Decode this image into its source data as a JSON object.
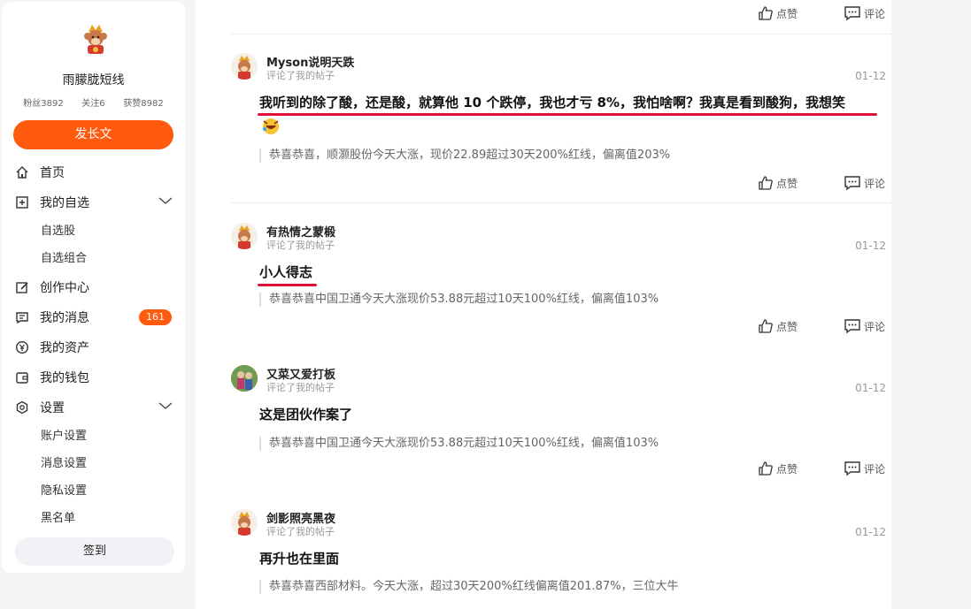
{
  "sidebar": {
    "user_name": "雨朦胧短线",
    "stats": {
      "fans": "粉丝3892",
      "follow": "关注6",
      "likes": "获赞8982"
    },
    "post_button": "发长文",
    "nav": [
      {
        "label": "首页",
        "icon": "home-icon"
      },
      {
        "label": "我的自选",
        "icon": "watchlist-icon"
      },
      {
        "label": "自选股"
      },
      {
        "label": "自选组合"
      },
      {
        "label": "创作中心",
        "icon": "edit-icon"
      },
      {
        "label": "我的消息",
        "icon": "message-icon",
        "badge": "161"
      },
      {
        "label": "我的资产",
        "icon": "asset-icon"
      },
      {
        "label": "我的钱包",
        "icon": "wallet-icon"
      },
      {
        "label": "设置",
        "icon": "settings-icon"
      },
      {
        "label": "账户设置"
      },
      {
        "label": "消息设置"
      },
      {
        "label": "隐私设置"
      },
      {
        "label": "黑名单"
      }
    ],
    "checkin_button": "签到"
  },
  "actions": {
    "like": "点赞",
    "comment": "评论"
  },
  "posts": [
    {
      "author": "Myson说明天跌",
      "subtitle": "评论了我的帖子",
      "date": "01-12",
      "content": "我听到的除了酸，还是酸，就算他 10 个跌停，我也才亏 8%，我怕啥啊？我真是看到酸狗，我想笑",
      "quote": "恭喜恭喜，顺灏股份今天大涨，现价22.89超过30天200%红线，偏离值203%"
    },
    {
      "author": "有热情之蒙椴",
      "subtitle": "评论了我的帖子",
      "date": "01-12",
      "content": "小人得志",
      "quote": "恭喜恭喜中国卫通今天大涨现价53.88元超过10天100%红线，偏离值103%"
    },
    {
      "author": "又菜又爱打板",
      "subtitle": "评论了我的帖子",
      "date": "01-12",
      "content": "这是团伙作案了",
      "quote": "恭喜恭喜中国卫通今天大涨现价53.88元超过10天100%红线，偏离值103%"
    },
    {
      "author": "剑影照亮黑夜",
      "subtitle": "评论了我的帖子",
      "date": "01-12",
      "content": "再升也在里面",
      "quote": "恭喜恭喜西部材料。今天大涨，超过30天200%红线偏离值201.87%，三位大牛"
    }
  ],
  "colors": {
    "accent": "#ff5a0e",
    "underline": "#e0103b"
  }
}
